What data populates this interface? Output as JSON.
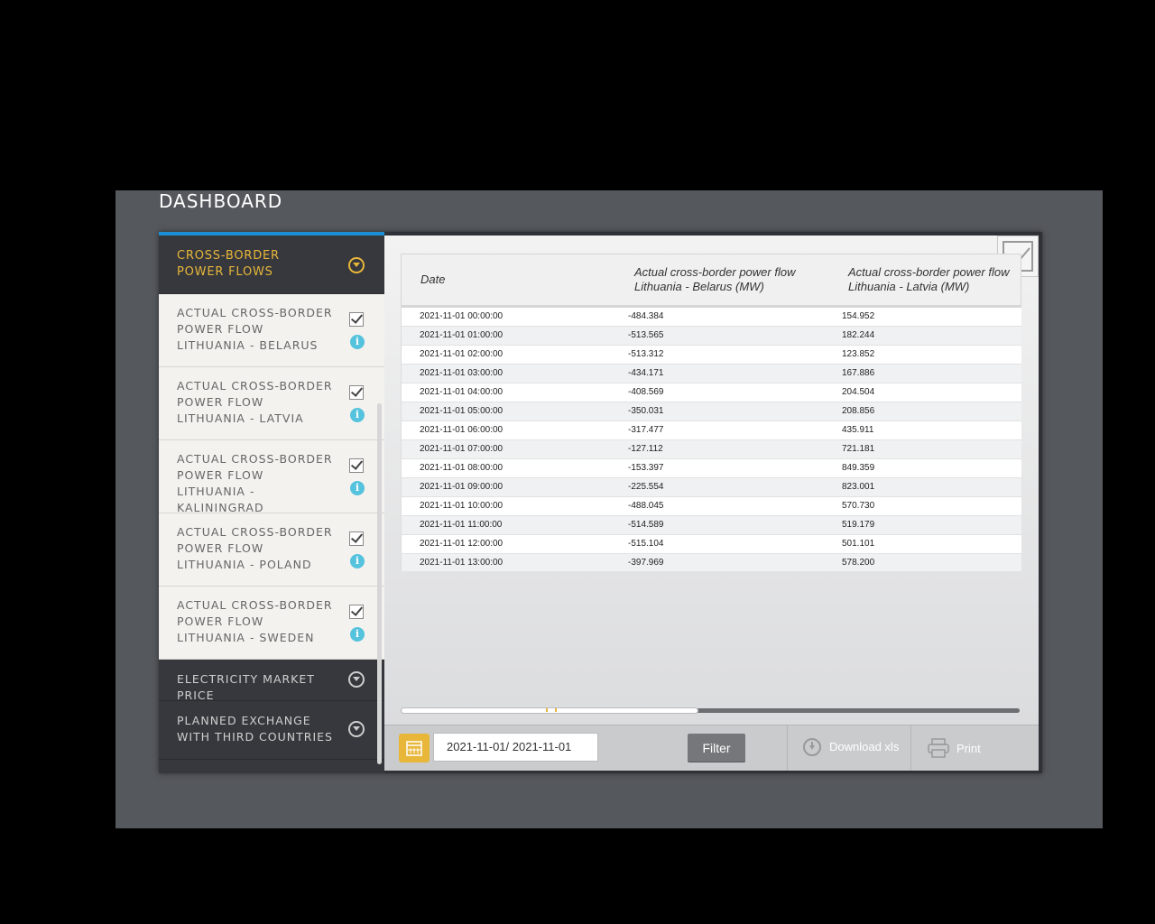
{
  "page": {
    "title": "DASHBOARD"
  },
  "sidebar": {
    "active_section": "CROSS-BORDER POWER FLOWS",
    "items": [
      {
        "label": "ACTUAL CROSS-BORDER POWER FLOW LITHUANIA - BELARUS",
        "checked": true
      },
      {
        "label": "ACTUAL CROSS-BORDER POWER FLOW LITHUANIA - LATVIA",
        "checked": true
      },
      {
        "label": "ACTUAL CROSS-BORDER POWER FLOW LITHUANIA - KALININGRAD",
        "checked": true
      },
      {
        "label": "ACTUAL CROSS-BORDER POWER FLOW LITHUANIA - POLAND",
        "checked": true
      },
      {
        "label": "ACTUAL CROSS-BORDER POWER FLOW LITHUANIA - SWEDEN",
        "checked": true
      }
    ],
    "sections": [
      {
        "label": "ELECTRICITY MARKET PRICE"
      },
      {
        "label": "PLANNED EXCHANGE WITH THIRD COUNTRIES"
      }
    ],
    "info_glyph": "i"
  },
  "table": {
    "headers": [
      "Date",
      "Actual cross-border power flow Lithuania - Belarus (MW)",
      "Actual cross-border power flow Lithuania - Latvia (MW)"
    ],
    "rows": [
      [
        "2021-11-01 00:00:00",
        "-484.384",
        "154.952"
      ],
      [
        "2021-11-01 01:00:00",
        "-513.565",
        "182.244"
      ],
      [
        "2021-11-01 02:00:00",
        "-513.312",
        "123.852"
      ],
      [
        "2021-11-01 03:00:00",
        "-434.171",
        "167.886"
      ],
      [
        "2021-11-01 04:00:00",
        "-408.569",
        "204.504"
      ],
      [
        "2021-11-01 05:00:00",
        "-350.031",
        "208.856"
      ],
      [
        "2021-11-01 06:00:00",
        "-317.477",
        "435.911"
      ],
      [
        "2021-11-01 07:00:00",
        "-127.112",
        "721.181"
      ],
      [
        "2021-11-01 08:00:00",
        "-153.397",
        "849.359"
      ],
      [
        "2021-11-01 09:00:00",
        "-225.554",
        "823.001"
      ],
      [
        "2021-11-01 10:00:00",
        "-488.045",
        "570.730"
      ],
      [
        "2021-11-01 11:00:00",
        "-514.589",
        "519.179"
      ],
      [
        "2021-11-01 12:00:00",
        "-515.104",
        "501.101"
      ],
      [
        "2021-11-01 13:00:00",
        "-397.969",
        "578.200"
      ]
    ]
  },
  "toolbar": {
    "date_range": "2021-11-01/ 2021-11-01",
    "filter_label": "Filter",
    "download_label": "Download xls",
    "print_label": "Print"
  },
  "colors": {
    "accent": "#e8b73a",
    "info": "#55c3dd",
    "top_bar": "#1a8fd6"
  },
  "icons": [
    "chevron-down-icon",
    "checkbox-icon",
    "info-icon",
    "line-chart-icon",
    "calendar-icon",
    "download-icon",
    "printer-icon"
  ]
}
